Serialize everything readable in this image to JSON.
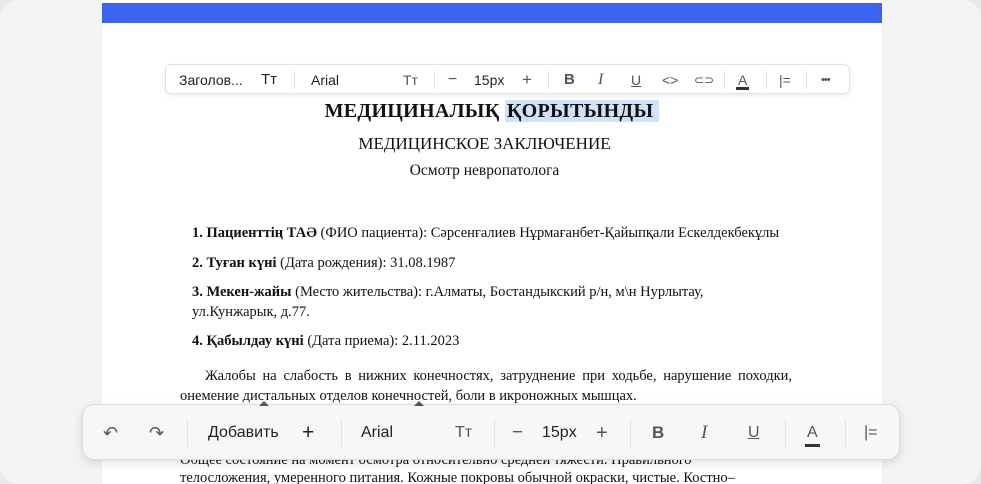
{
  "document": {
    "title_kz": "МЕДИЦИНАЛЫҚ ҚОРЫТЫНДЫ",
    "title_kz_part1": "МЕДИЦИНАЛЫҚ",
    "title_kz_part2": "ҚОРЫТЫНДЫ",
    "title_ru": "МЕДИЦИНСКОЕ ЗАКЛЮЧЕНИЕ",
    "subtitle": "Осмотр невропатолога",
    "fields": [
      {
        "label": "1. Пациенттің ТАӘ",
        "hint": " (ФИО пациента):",
        "value": "  Сәрсенғалиев Нұрмағанбет-Қайыпқали Ескелдекбекұлы"
      },
      {
        "label": "2. Туған күні",
        "hint": " (Дата рождения):",
        "value": "  31.08.1987"
      },
      {
        "label": "3. Мекен-жайы",
        "hint": " (Место жительства):",
        "value": "  г.Алматы, Бостандыкский р/н, м\\н Нурлытау,",
        "value2": "ул.Кунжарык, д.77."
      },
      {
        "label": "4. Қабылдау күні",
        "hint": " (Дата приема):",
        "value": "   2.11.2023"
      }
    ],
    "complaints": "Жалобы на слабость в нижних конечностях, затруднение при ходьбе, нарушение походки, онемение дистальных отделов конечностей, боли в икроножных мышцах.",
    "status_line1": "Общее состояние на момент осмотра относительно средней тяжести. Правильного",
    "status_line2": "телосложения, умеренного питания. Кожные покровы обычной окраски, чистые. Костно–"
  },
  "top_toolbar": {
    "style_label": "Заголов...",
    "text_type_label": "Тт",
    "font_label": "Arial",
    "font_size_icon": "Тт",
    "minus": "−",
    "size": "15px",
    "plus": "+",
    "bold": "B",
    "italic": "I",
    "underline": "U",
    "code": "<>",
    "link": "⊂⊃",
    "color": "A",
    "align": "|=",
    "more": "•••"
  },
  "bottom_toolbar": {
    "undo": "↶",
    "redo": "↷",
    "add_label": "Добавить",
    "add_plus": "+",
    "font_label": "Arial",
    "font_size_icon": "Тт",
    "minus": "−",
    "size": "15px",
    "plus": "+",
    "bold": "B",
    "italic": "I",
    "underline": "U",
    "color": "A",
    "align": "|="
  }
}
